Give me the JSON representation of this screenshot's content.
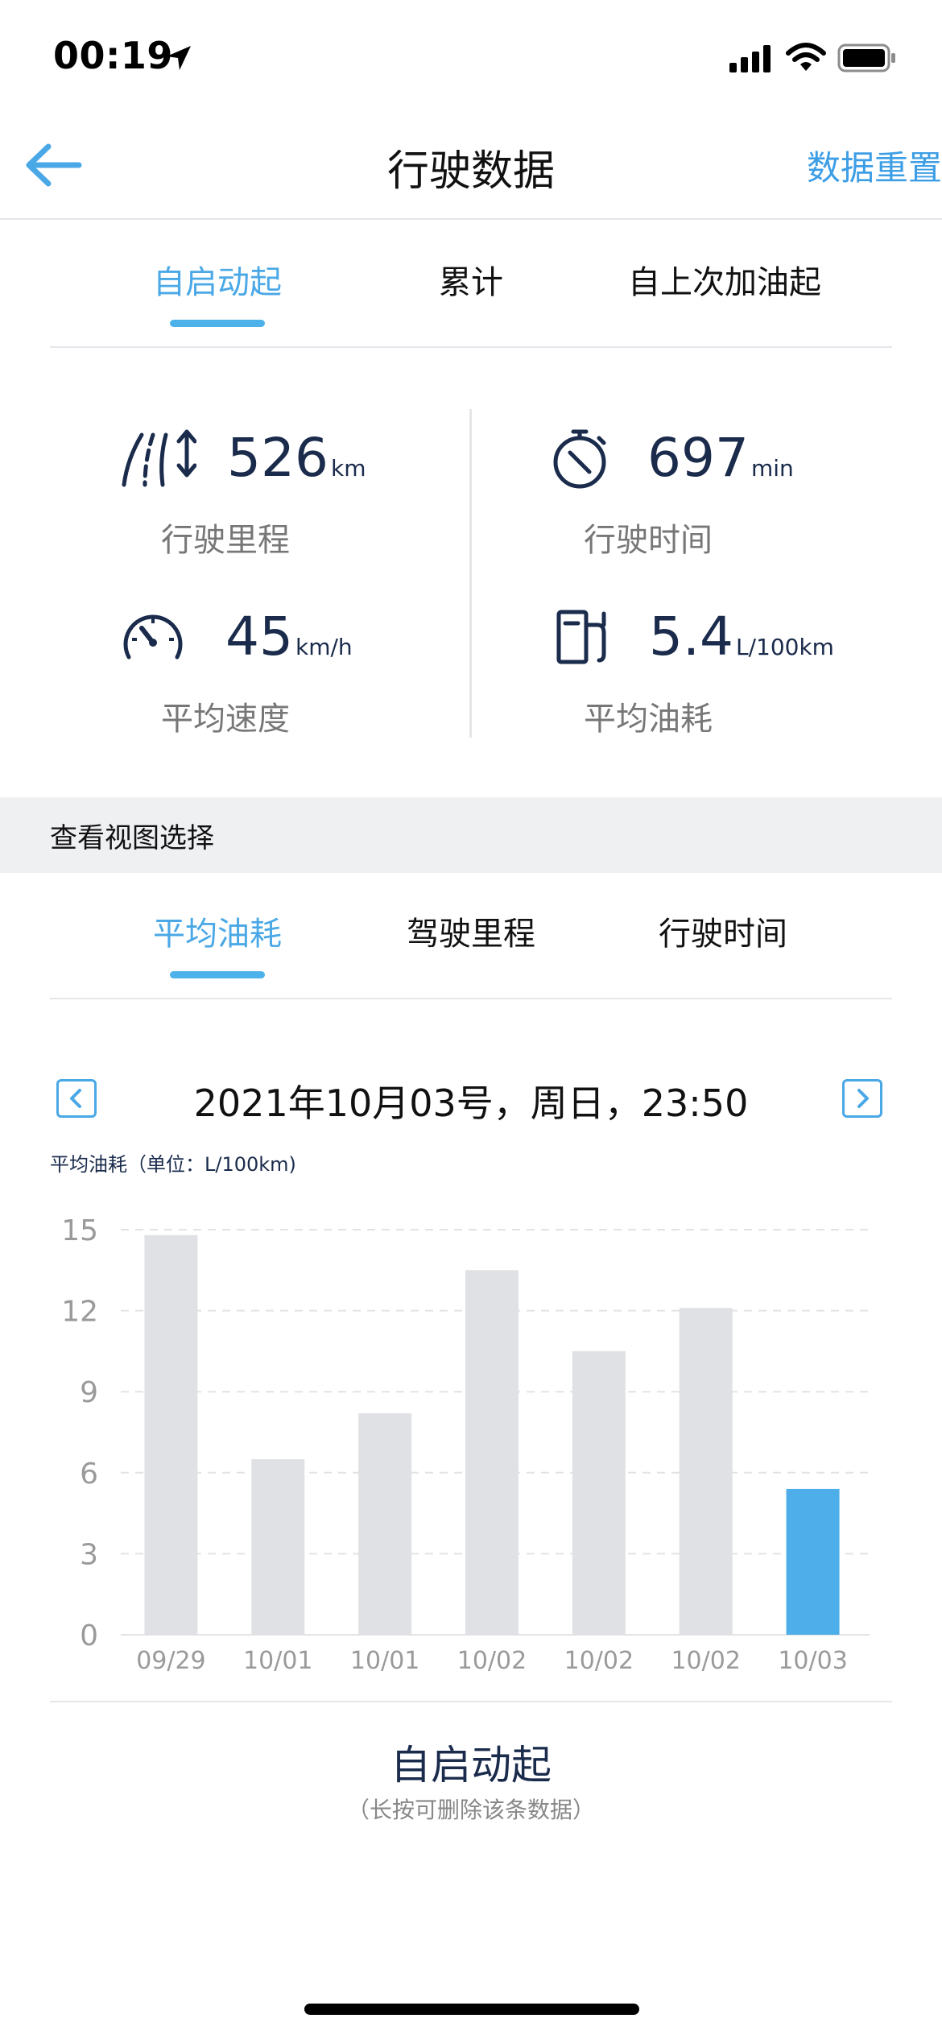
{
  "status_bar": {
    "time": "00:19"
  },
  "nav": {
    "title": "行驶数据",
    "reset_label": "数据重置"
  },
  "top_tabs": [
    {
      "label": "自启动起",
      "active": true
    },
    {
      "label": "累计",
      "active": false
    },
    {
      "label": "自上次加油起",
      "active": false
    }
  ],
  "stats": {
    "distance": {
      "value": "526",
      "unit": "km",
      "label": "行驶里程",
      "icon": "road-distance-icon"
    },
    "time": {
      "value": "697",
      "unit": "min",
      "label": "行驶时间",
      "icon": "stopwatch-icon"
    },
    "speed": {
      "value": "45",
      "unit": "km/h",
      "label": "平均速度",
      "icon": "speedometer-icon"
    },
    "fuel": {
      "value": "5.4",
      "unit": "L/100km",
      "label": "平均油耗",
      "icon": "fuel-pump-icon"
    }
  },
  "view_select": {
    "label": "查看视图选择"
  },
  "view_tabs": [
    {
      "label": "平均油耗",
      "active": true
    },
    {
      "label": "驾驶里程",
      "active": false
    },
    {
      "label": "行驶时间",
      "active": false
    }
  ],
  "date_nav": {
    "text": "2021年10月03号，周日，23:50"
  },
  "chart_data": {
    "type": "bar",
    "title": "平均油耗（单位：L/100km)",
    "categories": [
      "09/29",
      "10/01",
      "10/01",
      "10/02",
      "10/02",
      "10/02",
      "10/03"
    ],
    "values": [
      14.8,
      6.5,
      8.2,
      13.5,
      10.5,
      12.1,
      5.4
    ],
    "highlight_index": 6,
    "ylim": [
      0,
      15
    ],
    "yticks": [
      "0",
      "3",
      "6",
      "9",
      "12",
      "15"
    ],
    "grid": true,
    "colors": {
      "bar": "#dfe1e4",
      "highlight": "#4daee9",
      "grid": "#e3e3e3",
      "tick": "#9a9a9a"
    }
  },
  "bottom": {
    "title": "自启动起",
    "hint": "（长按可删除该条数据）"
  },
  "colors": {
    "accent": "#4aa8e6",
    "text_dark": "#1a2b4c"
  }
}
